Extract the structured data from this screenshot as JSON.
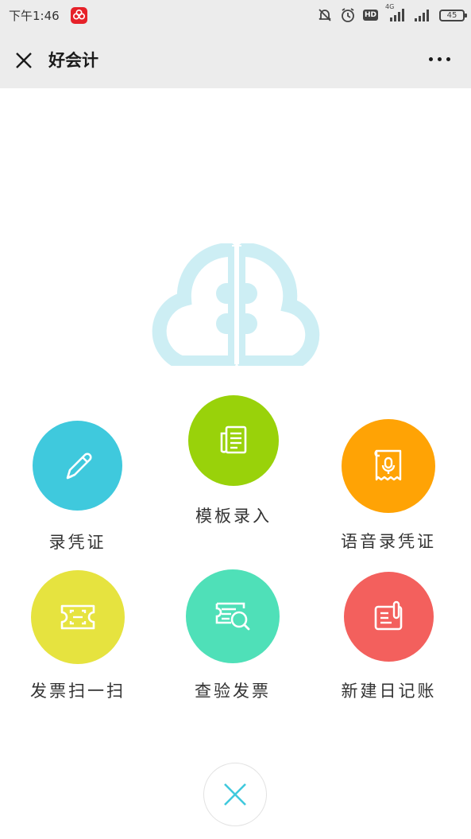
{
  "status_bar": {
    "time": "下午1:46",
    "signal_label": "4G",
    "battery": "45"
  },
  "header": {
    "title": "好会计"
  },
  "colors": {
    "accent_blue": "#3fc9dd",
    "green": "#99d20a",
    "orange": "#ffa305",
    "yellow": "#e6e33f",
    "teal": "#4fe0b8",
    "red": "#f3605d",
    "logo": "#cdeef4"
  },
  "actions": [
    {
      "label": "录凭证",
      "icon": "pencil-icon"
    },
    {
      "label": "模板录入",
      "icon": "document-icon"
    },
    {
      "label": "语音录凭证",
      "icon": "voice-receipt-icon"
    },
    {
      "label": "发票扫一扫",
      "icon": "scan-ticket-icon"
    },
    {
      "label": "查验发票",
      "icon": "invoice-search-icon"
    },
    {
      "label": "新建日记账",
      "icon": "journal-icon"
    }
  ]
}
